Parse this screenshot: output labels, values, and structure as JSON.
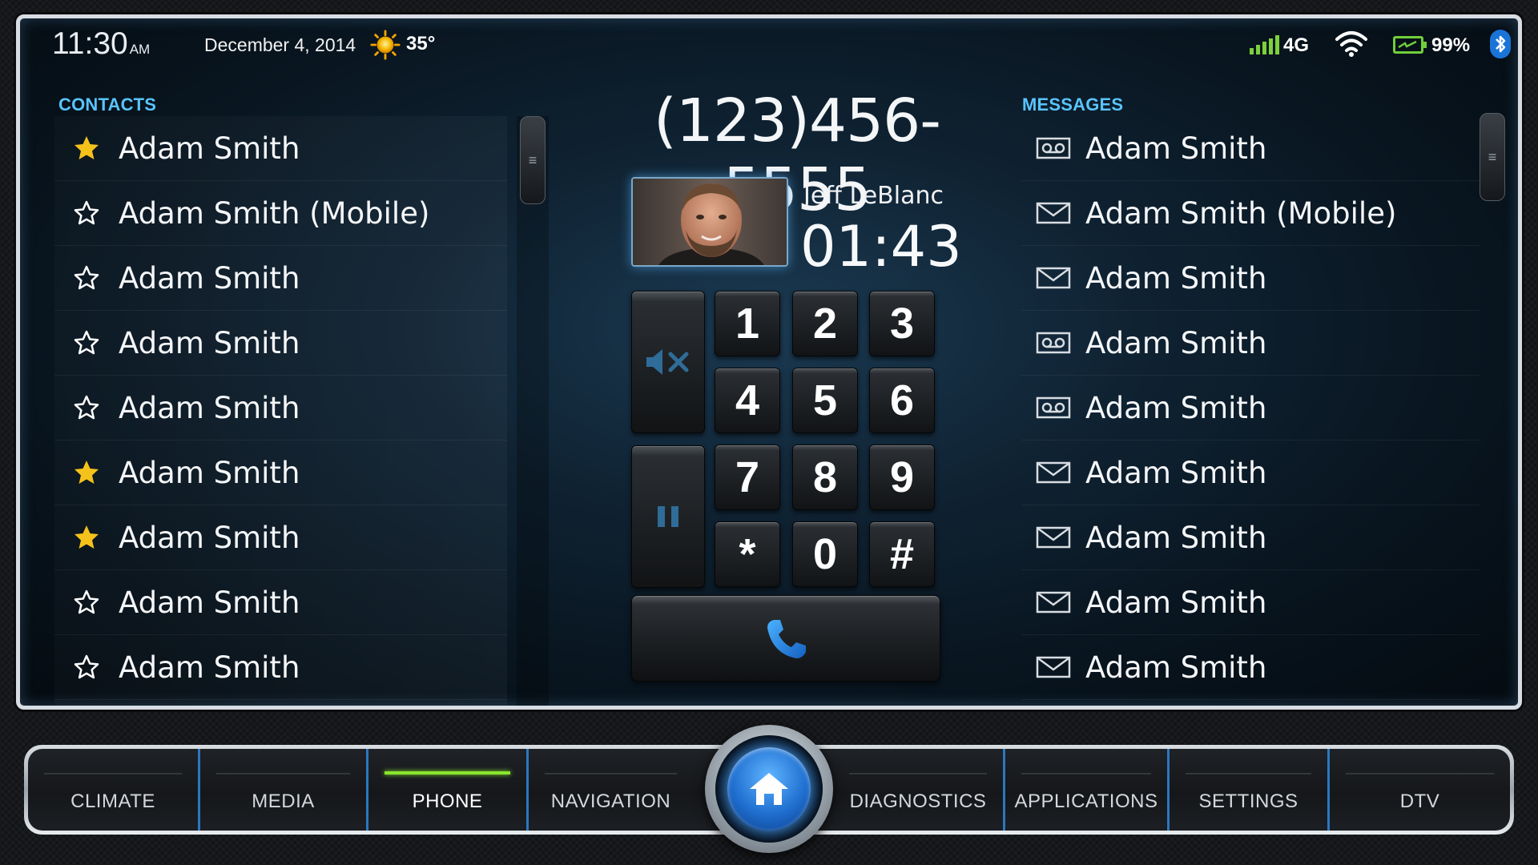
{
  "status": {
    "time": "11:30",
    "ampm": "AM",
    "date": "December 4, 2014",
    "weather_icon": "sun-icon",
    "temperature": "35°",
    "network": "4G",
    "battery": "99%",
    "battery_level": 0.99
  },
  "contacts": {
    "title": "CONTACTS",
    "items": [
      {
        "name": "Adam Smith",
        "favorite": true
      },
      {
        "name": "Adam Smith (Mobile)",
        "favorite": false
      },
      {
        "name": "Adam Smith",
        "favorite": false
      },
      {
        "name": "Adam Smith",
        "favorite": false
      },
      {
        "name": "Adam Smith",
        "favorite": false
      },
      {
        "name": "Adam Smith",
        "favorite": true
      },
      {
        "name": "Adam Smith",
        "favorite": true
      },
      {
        "name": "Adam Smith",
        "favorite": false
      },
      {
        "name": "Adam Smith",
        "favorite": false
      }
    ]
  },
  "dialer": {
    "number": "(123)456-5555",
    "caller_name": "Jeff LeBlanc",
    "call_duration": "01:43",
    "keys": [
      "1",
      "2",
      "3",
      "4",
      "5",
      "6",
      "7",
      "8",
      "9",
      "*",
      "0",
      "#"
    ],
    "mute_icon": "mute-icon",
    "hold_icon": "pause-icon",
    "call_icon": "phone-icon"
  },
  "messages": {
    "title": "MESSAGES",
    "items": [
      {
        "name": "Adam Smith",
        "type": "voicemail"
      },
      {
        "name": "Adam Smith (Mobile)",
        "type": "text"
      },
      {
        "name": "Adam Smith",
        "type": "text"
      },
      {
        "name": "Adam Smith",
        "type": "voicemail"
      },
      {
        "name": "Adam Smith",
        "type": "voicemail"
      },
      {
        "name": "Adam Smith",
        "type": "text"
      },
      {
        "name": "Adam Smith",
        "type": "text"
      },
      {
        "name": "Adam Smith",
        "type": "text"
      },
      {
        "name": "Adam Smith",
        "type": "text"
      }
    ]
  },
  "nav": {
    "items": [
      "CLIMATE",
      "MEDIA",
      "PHONE",
      "NAVIGATION",
      "DIAGNOSTICS",
      "APPLICATIONS",
      "SETTINGS",
      "DTV"
    ],
    "active": "PHONE",
    "home_icon": "home-icon"
  },
  "colors": {
    "accent": "#59c4ff",
    "active_indicator": "#8ae62d",
    "star": "#f5c21b",
    "signal": "#7bd23a"
  }
}
